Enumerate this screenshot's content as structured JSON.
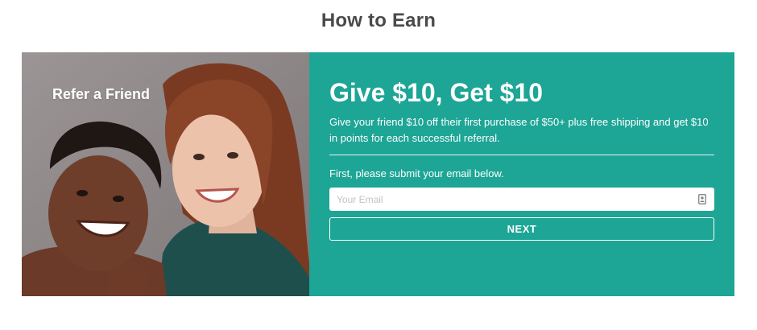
{
  "page": {
    "title": "How to Earn"
  },
  "referral": {
    "image_label": "Refer a Friend",
    "headline": "Give $10, Get $10",
    "description": "Give your friend $10 off their first purchase of $50+ plus free shipping and get $10 in points for each successful referral.",
    "email_prompt": "First, please submit your email below.",
    "email_placeholder": "Your Email",
    "email_value": "",
    "next_label": "NEXT",
    "field_icon": "contact-card-icon"
  },
  "colors": {
    "panel_accent": "#1da596",
    "photo_background": "#8c8687",
    "title_text": "#4a4a4a"
  }
}
